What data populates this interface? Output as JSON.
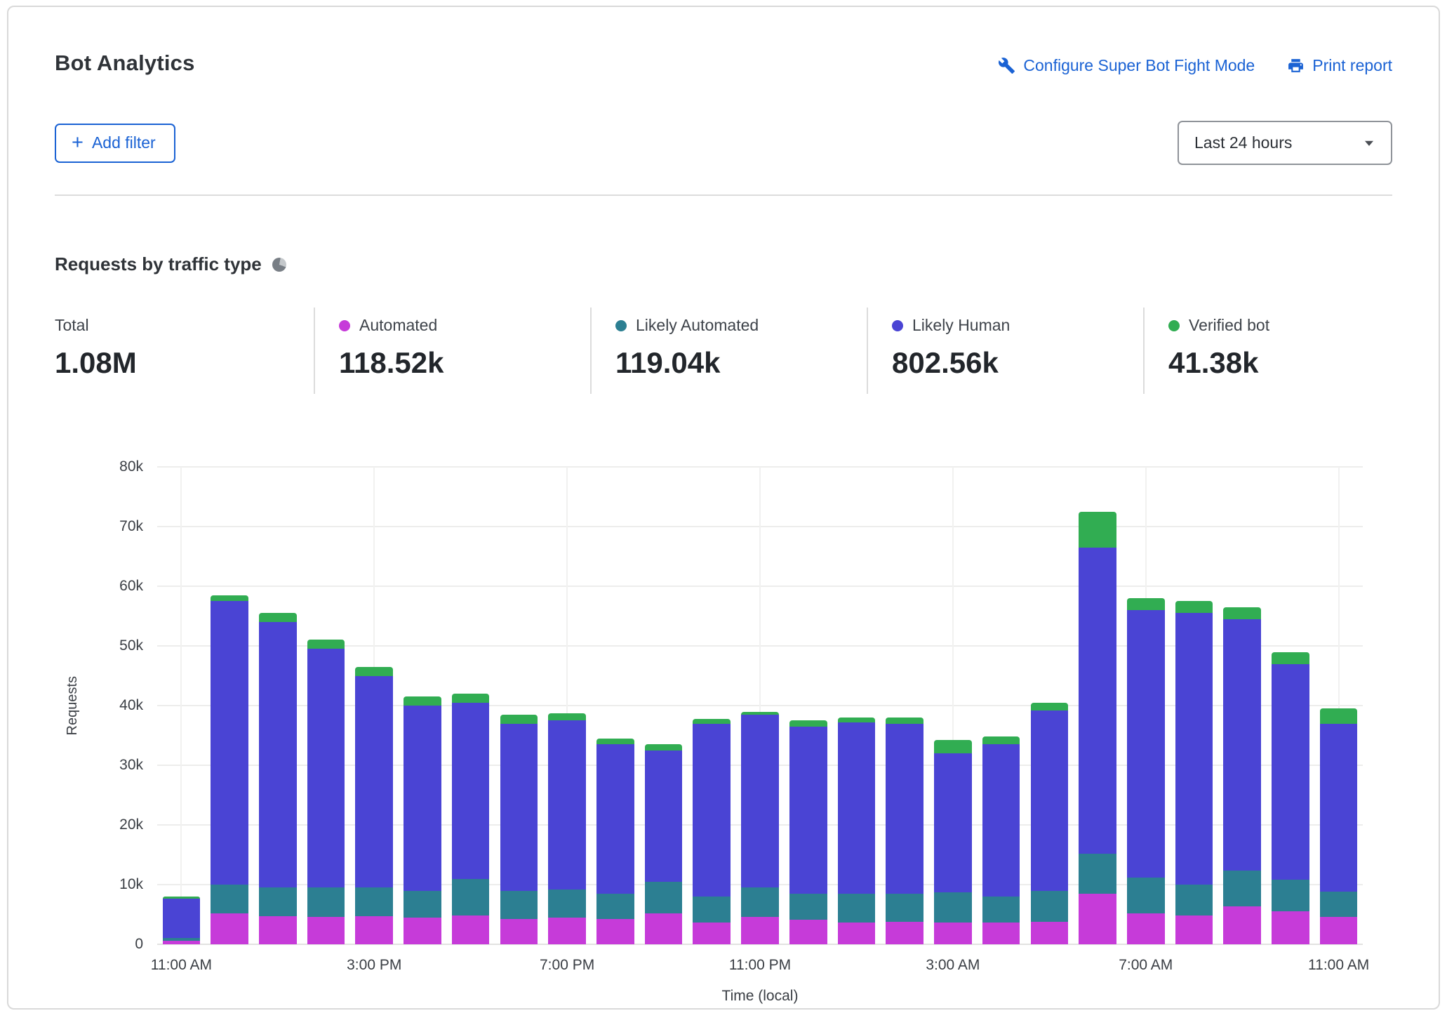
{
  "colors": {
    "link_blue": "#1A62D4",
    "divider": "#DCDCDC",
    "automated": "#C63BD9",
    "likely_automated": "#2C7F92",
    "likely_human": "#4A44D4",
    "verified_bot": "#31AD52"
  },
  "header": {
    "title": "Bot Analytics",
    "configure_link": "Configure Super Bot Fight Mode",
    "print_link": "Print report",
    "add_filter_label": "Add filter",
    "time_range_value": "Last 24 hours"
  },
  "section": {
    "title": "Requests by traffic type"
  },
  "stats": [
    {
      "label": "Total",
      "value": "1.08M",
      "dot": null
    },
    {
      "label": "Automated",
      "value": "118.52k",
      "dot": "#C63BD9"
    },
    {
      "label": "Likely Automated",
      "value": "119.04k",
      "dot": "#2C7F92"
    },
    {
      "label": "Likely Human",
      "value": "802.56k",
      "dot": "#4A44D4"
    },
    {
      "label": "Verified bot",
      "value": "41.38k",
      "dot": "#31AD52"
    }
  ],
  "chart_data": {
    "type": "bar",
    "stacked": true,
    "title": "Requests by traffic type",
    "xlabel": "Time (local)",
    "ylabel": "Requests",
    "ylim": [
      0,
      80000
    ],
    "ytick_labels": [
      "0",
      "10k",
      "20k",
      "30k",
      "40k",
      "50k",
      "60k",
      "70k",
      "80k"
    ],
    "xtick_every": 4,
    "grid": true,
    "x": [
      "11:00 AM",
      "12:00 PM",
      "1:00 PM",
      "2:00 PM",
      "3:00 PM",
      "4:00 PM",
      "5:00 PM",
      "6:00 PM",
      "7:00 PM",
      "8:00 PM",
      "9:00 PM",
      "10:00 PM",
      "11:00 PM",
      "12:00 AM",
      "1:00 AM",
      "2:00 AM",
      "3:00 AM",
      "4:00 AM",
      "5:00 AM",
      "6:00 AM",
      "7:00 AM",
      "8:00 AM",
      "9:00 AM",
      "10:00 AM",
      "11:00 AM"
    ],
    "series": [
      {
        "name": "Automated",
        "color": "#C63BD9",
        "values": [
          600,
          5200,
          4700,
          4600,
          4700,
          4500,
          4800,
          4200,
          4500,
          4200,
          5200,
          3600,
          4600,
          4100,
          3600,
          3800,
          3600,
          3600,
          3800,
          8500,
          5200,
          4800,
          6300,
          5500,
          4600
        ]
      },
      {
        "name": "Likely Automated",
        "color": "#2C7F92",
        "values": [
          500,
          4800,
          4800,
          4900,
          4800,
          4500,
          6200,
          4800,
          4700,
          4300,
          5300,
          4400,
          4900,
          4400,
          4900,
          4700,
          5100,
          4400,
          5200,
          6700,
          6000,
          5200,
          6000,
          5300,
          4200
        ]
      },
      {
        "name": "Likely Human",
        "color": "#4A44D4",
        "values": [
          6600,
          47500,
          44500,
          40000,
          35500,
          31000,
          29500,
          28000,
          28300,
          25000,
          22000,
          29000,
          29000,
          28000,
          28700,
          28500,
          23300,
          25500,
          30200,
          51300,
          44800,
          45500,
          42200,
          36200,
          28200
        ]
      },
      {
        "name": "Verified bot",
        "color": "#31AD52",
        "values": [
          300,
          1000,
          1500,
          1600,
          1500,
          1500,
          1500,
          1500,
          1200,
          1000,
          1000,
          800,
          500,
          1000,
          800,
          1000,
          2200,
          1300,
          1300,
          6000,
          2000,
          2000,
          2000,
          2000,
          2500
        ]
      }
    ]
  }
}
